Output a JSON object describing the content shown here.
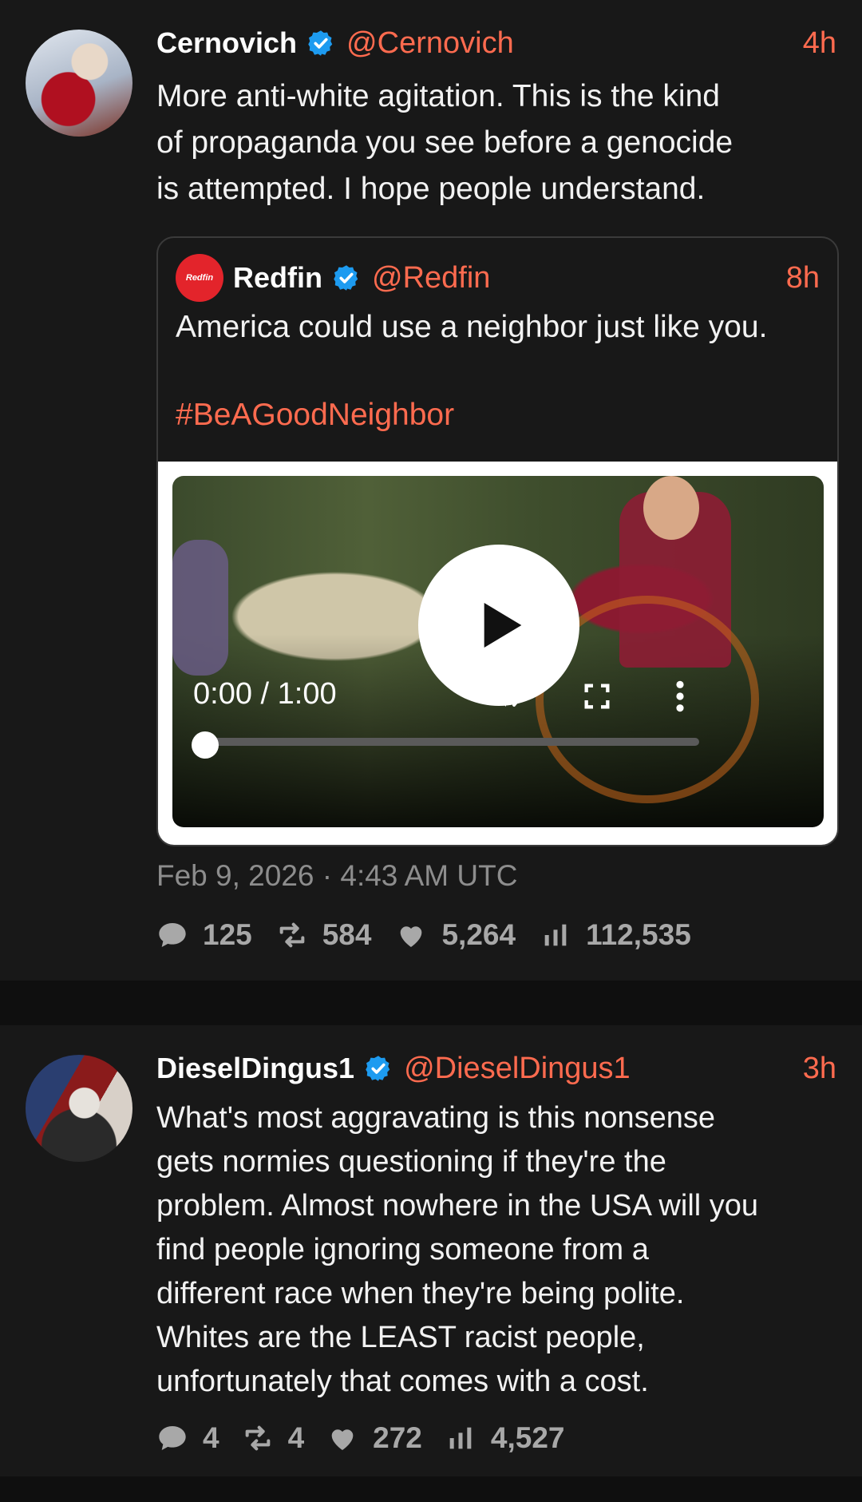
{
  "colors": {
    "accent": "#ff6b4f",
    "verified": "#1d9bf0",
    "background": "#181818",
    "muted": "#8d8d8d"
  },
  "tweet1": {
    "name": "Cernovich",
    "handle": "@Cernovich",
    "time": "4h",
    "text": "More anti-white agitation. This is the kind\nof propaganda you see before a genocide\nis attempted. I hope people understand.",
    "quote": {
      "avatar_text": "Redfin",
      "name": "Redfin",
      "handle": "@Redfin",
      "time": "8h",
      "text": "America could use a neighbor just like you.",
      "hashtag": "#BeAGoodNeighbor",
      "video": {
        "time_display": "0:00 / 1:00",
        "progress": 0.0
      }
    },
    "date": "Feb 9, 2026 · 4:43 AM UTC",
    "stats": {
      "replies": "125",
      "retweets": "584",
      "likes": "5,264",
      "views": "112,535"
    }
  },
  "tweet2": {
    "name": "DieselDingus1",
    "handle": "@DieselDingus1",
    "time": "3h",
    "text": "What's most aggravating is this nonsense\ngets normies questioning if they're the\nproblem. Almost nowhere in the USA will you\nfind people ignoring someone from a\ndifferent race when they're being polite.\nWhites are the LEAST racist people,\nunfortunately that comes with a cost.",
    "stats": {
      "replies": "4",
      "retweets": "4",
      "likes": "272",
      "views": "4,527"
    }
  }
}
